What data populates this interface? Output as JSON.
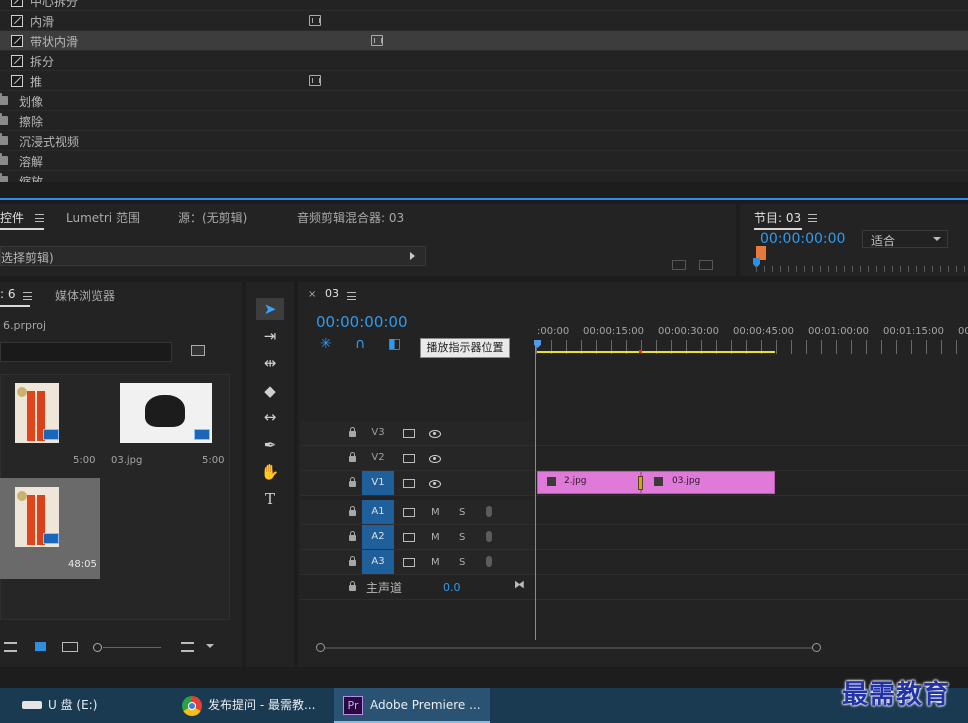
{
  "effects": {
    "rows": [
      {
        "label": "中心拆分",
        "type": "effect"
      },
      {
        "label": "内滑",
        "type": "effect",
        "badge": true
      },
      {
        "label": "带状内滑",
        "type": "effect",
        "badge": true,
        "selected": true
      },
      {
        "label": "拆分",
        "type": "effect"
      },
      {
        "label": "推",
        "type": "effect",
        "badge": true
      },
      {
        "label": "划像",
        "type": "folder"
      },
      {
        "label": "擦除",
        "type": "folder"
      },
      {
        "label": "沉浸式视频",
        "type": "folder"
      },
      {
        "label": "溶解",
        "type": "folder"
      },
      {
        "label": "缩放",
        "type": "folder"
      }
    ]
  },
  "controls": {
    "tabs": [
      "控件",
      "Lumetri 范围",
      "源：(无剪辑)",
      "音频剪辑混合器: 03"
    ],
    "clip_select": "选择剪辑)"
  },
  "program": {
    "title": "节目: 03",
    "timecode": "00:00:00:00",
    "fit": "适合"
  },
  "project": {
    "tab_title": ": 6",
    "media_browser": "媒体浏览器",
    "file": "6.prproj",
    "items": [
      {
        "name": "",
        "duration": "5:00"
      },
      {
        "name": "03.jpg",
        "duration": "5:00"
      },
      {
        "name": "",
        "duration": "48:05"
      }
    ]
  },
  "timeline": {
    "sequence": "03",
    "timecode": "00:00:00:00",
    "ruler": [
      ":00:00",
      "00:00:15:00",
      "00:00:30:00",
      "00:00:45:00",
      "00:01:00:00",
      "00:01:15:00",
      "00"
    ],
    "tooltip": "播放指示器位置",
    "video_tracks": [
      "V3",
      "V2",
      "V1"
    ],
    "audio_tracks": [
      "A1",
      "A2",
      "A3"
    ],
    "mute": "M",
    "solo": "S",
    "master": {
      "label": "主声道",
      "value": "0.0"
    },
    "clips": [
      "2.jpg",
      "03.jpg"
    ]
  },
  "taskbar": {
    "drive": "U 盘 (E:)",
    "chrome": "发布提问 - 最需教...",
    "premiere": "Adobe Premiere ...",
    "premiere_icon": "Pr"
  },
  "watermark": "最需教育",
  "colors": {
    "accent": "#2e9bf0",
    "clip": "#e07ad9",
    "track_on": "#1e5f9c"
  }
}
